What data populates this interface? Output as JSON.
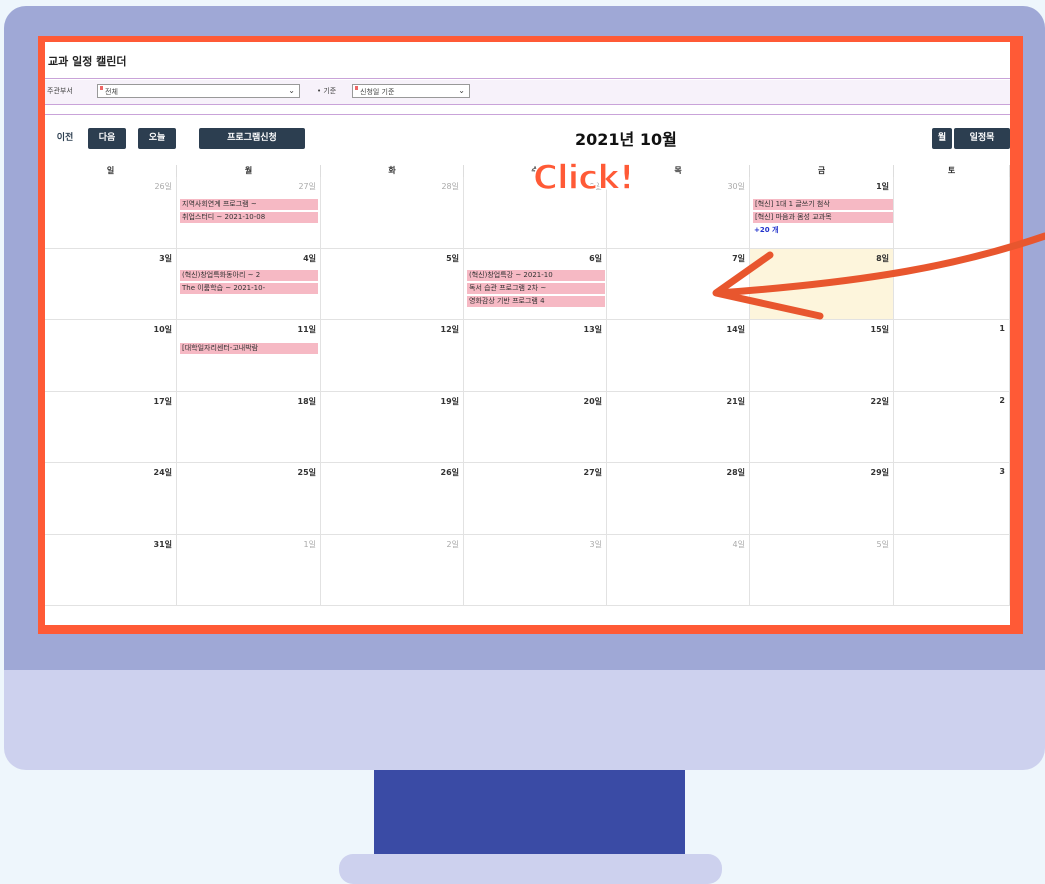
{
  "app": {
    "title": "교과 일정 캘린더"
  },
  "filters": {
    "dept_label": "주관부서",
    "dept_value": "전체",
    "basis_label": "• 기준",
    "basis_value": "신청일 기준"
  },
  "toolbar": {
    "prev_label": "이전",
    "next_label": "다음",
    "today_label": "오늘",
    "apply_label": "프로그램신청",
    "month_title": "2021년 10월",
    "month_view_label": "월",
    "schedule_label": "일정목"
  },
  "weekdays": [
    "일",
    "월",
    "화",
    "수",
    "목",
    "금",
    "토"
  ],
  "weeks": [
    [
      "26일",
      "27일",
      "28일",
      "29일",
      "30일",
      "1일",
      ""
    ],
    [
      "3일",
      "4일",
      "5일",
      "6일",
      "7일",
      "8일",
      ""
    ],
    [
      "10일",
      "11일",
      "12일",
      "13일",
      "14일",
      "15일",
      "1"
    ],
    [
      "17일",
      "18일",
      "19일",
      "20일",
      "21일",
      "22일",
      "2"
    ],
    [
      "24일",
      "25일",
      "26일",
      "27일",
      "28일",
      "29일",
      "3"
    ],
    [
      "31일",
      "1일",
      "2일",
      "3일",
      "4일",
      "5일",
      ""
    ]
  ],
  "events": {
    "w1_mon_1": "지역사회연계 프로그램 ~",
    "w1_mon_2": "취업스터디 ~ 2021-10-08",
    "w1_fri_1": "[혁신] 1대 1 글쓰기 첨삭",
    "w1_fri_2": "[혁신] 마음과 몸성 교과목",
    "w1_fri_more": "+20 개",
    "w2_mon_1": "(혁신)창업특화동아리 ~ 2",
    "w2_mon_2": "The 이룸학습 ~ 2021-10-",
    "w2_wed_1": "(혁신)창업특강 ~ 2021-10",
    "w2_wed_2": "독서 습관 프로그램 2차 ~",
    "w2_wed_3": "영화감상 기반 프로그램 4",
    "w3_mon_1": "[대학일자리센터-고내박람"
  },
  "annotation": {
    "click_text": "Click!"
  },
  "colors": {
    "accent": "#ff5a36",
    "event_bg": "#f6b9c4",
    "button_bg": "#2c3e50",
    "today_bg": "#fdf5dc"
  }
}
